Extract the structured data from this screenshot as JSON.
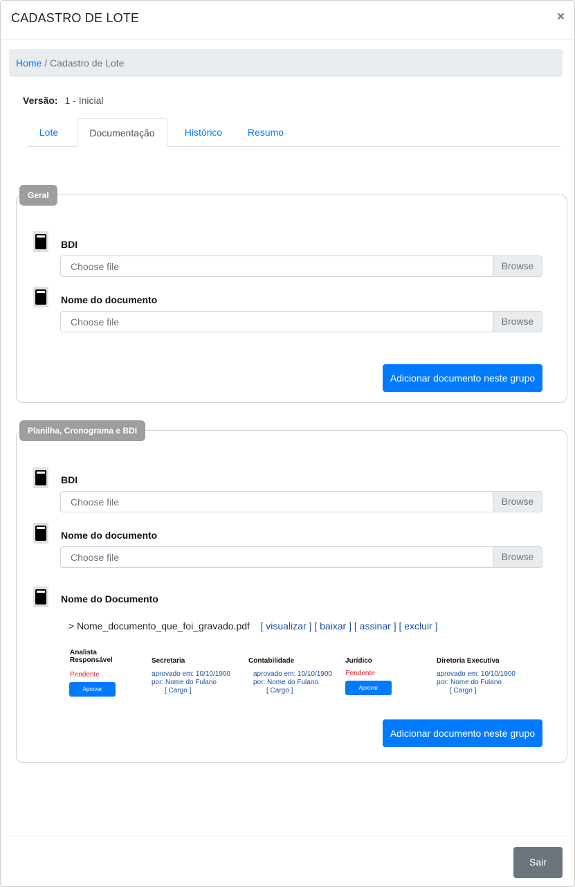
{
  "header": {
    "title": "CADASTRO DE LOTE",
    "close": "×"
  },
  "breadcrumb": {
    "home": "Home",
    "separator": "/",
    "current": "Cadastro de Lote"
  },
  "versao": {
    "label": "Versão:",
    "value": "1 - Inicial"
  },
  "tabs": [
    {
      "label": "Lote",
      "active": false
    },
    {
      "label": "Documentação",
      "active": true
    },
    {
      "label": "Histórico",
      "active": false
    },
    {
      "label": "Resumo",
      "active": false
    }
  ],
  "groups": [
    {
      "legend": "Geral",
      "documents": [
        {
          "label": "BDI",
          "placeholder": "Choose file",
          "browse": "Browse"
        },
        {
          "label": "Nome do documento",
          "placeholder": "Choose file",
          "browse": "Browse"
        }
      ],
      "add_button": "Adicionar documento neste grupo"
    },
    {
      "legend": "Planilha, Cronograma e BDI",
      "documents": [
        {
          "label": "BDI",
          "placeholder": "Choose file",
          "browse": "Browse"
        },
        {
          "label": "Nome do documento",
          "placeholder": "Choose file",
          "browse": "Browse"
        }
      ],
      "uploaded": {
        "label": "Nome do Documento",
        "filename": "> Nome_documento_que_foi_gravado.pdf",
        "actions": [
          "[ visualizar ]",
          "[ baixar ]",
          "[ assinar ]",
          "[ excluir ]"
        ],
        "approvals": [
          {
            "role": "Analista Responsável",
            "status": "Pendente",
            "button": "Aprovar"
          },
          {
            "role": "Secretaria",
            "line1": "aprovado em: 10/10/1900",
            "line2": "por: Nome do Fulano",
            "line3": "[ Cargo ]"
          },
          {
            "role": "Contabilidade",
            "line1": "aprovado em: 10/10/1900",
            "line2": "por: Nome do Fulano",
            "line3": "[ Cargo ]"
          },
          {
            "role": "Jurídico",
            "status": "Pendente",
            "button": "Aprovar"
          },
          {
            "role": "Diretoria Executiva",
            "line1": "aprovado em: 10/10/1900",
            "line2": "por: Nome do Fulano",
            "line3": "[ Cargo ]"
          }
        ]
      },
      "add_button": "Adicionar documento neste grupo"
    }
  ],
  "footer": {
    "exit": "Sair"
  },
  "colors": {
    "primary": "#007bff",
    "secondary": "#6c757d",
    "legend_bg": "#9e9e9e",
    "pending": "#e02020",
    "link": "#1a4fa0"
  }
}
